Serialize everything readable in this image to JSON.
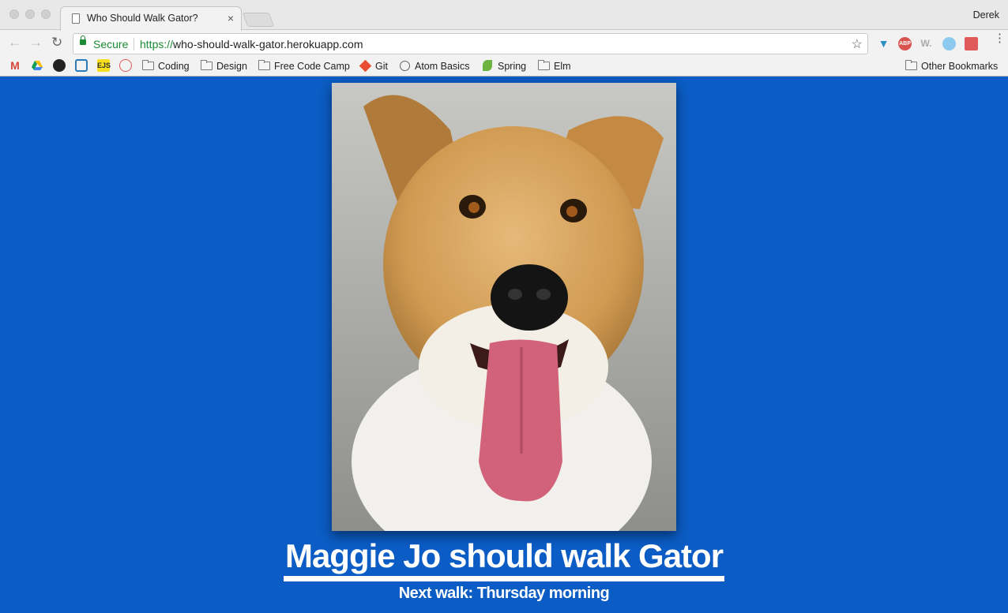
{
  "browser": {
    "tab_title": "Who Should Walk Gator?",
    "tab_close": "×",
    "profile_name": "Derek",
    "secure_label": "Secure",
    "url_protocol": "https://",
    "url_host": "who-should-walk-gator.herokuapp.com",
    "bookmarks": [
      {
        "label": "Coding",
        "type": "folder"
      },
      {
        "label": "Design",
        "type": "folder"
      },
      {
        "label": "Free Code Camp",
        "type": "folder"
      },
      {
        "label": "Git",
        "type": "site"
      },
      {
        "label": "Atom Basics",
        "type": "site"
      },
      {
        "label": "Spring",
        "type": "site"
      },
      {
        "label": "Elm",
        "type": "folder"
      }
    ],
    "other_bookmarks": "Other Bookmarks",
    "bookmark_icons": [
      "gmail-icon",
      "google-drive-icon",
      "github-icon",
      "codepen-icon",
      "ejs-icon",
      "sass-icon"
    ],
    "extension_icons": [
      "vue-devtools-icon",
      "adblock-plus-icon",
      "wappalyzer-icon",
      "extension-icon",
      "extension-icon"
    ]
  },
  "page": {
    "photo_subject": "dog-photo",
    "headline": "Maggie Jo should walk Gator",
    "next_walk": "Next walk: Thursday morning"
  },
  "colors": {
    "background": "#0b5cc4",
    "secure_green": "#1a8a34",
    "text": "#ffffff"
  }
}
